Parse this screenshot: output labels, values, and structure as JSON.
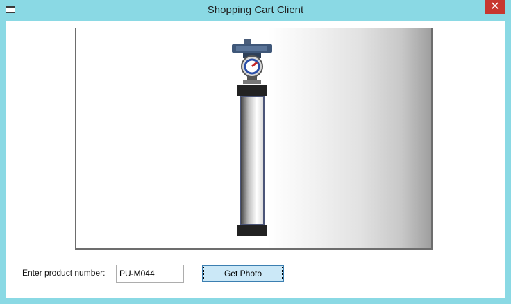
{
  "window": {
    "title": "Shopping Cart Client",
    "close_glyph": "✕",
    "accent_color": "#8ad9e4",
    "close_color": "#c7372f"
  },
  "form": {
    "prompt": "Enter product number:",
    "product_number": "PU-M044",
    "button_label": "Get Photo"
  },
  "photo": {
    "subject": "pump-icon"
  }
}
